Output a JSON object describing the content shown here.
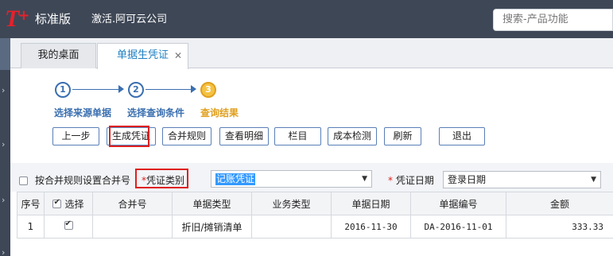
{
  "app": {
    "logo_mark": "T",
    "edition": "标准版",
    "company": "激活.阿可云公司",
    "search_placeholder": "搜索-产品功能"
  },
  "tabs": [
    {
      "label": "我的桌面"
    },
    {
      "label": "单据生凭证"
    }
  ],
  "steps": [
    {
      "number": "1",
      "label": "选择来源单据"
    },
    {
      "number": "2",
      "label": "选择查询条件"
    },
    {
      "number": "3",
      "label": "查询结果"
    }
  ],
  "toolbar": {
    "prev": "上一步",
    "generate": "生成凭证",
    "merge_rule": "合并规则",
    "view_detail": "查看明细",
    "columns": "栏目",
    "cost_check": "成本检测",
    "refresh": "刷新",
    "exit": "退出"
  },
  "filter": {
    "merge_checkbox_label": "按合并规则设置合并号",
    "merge_checked": false,
    "required_mark": "*",
    "voucher_type_label": "凭证类别",
    "voucher_type_value": "记账凭证",
    "voucher_date_label": "凭证日期",
    "voucher_date_value": "登录日期"
  },
  "table": {
    "headers": [
      "序号",
      "选择",
      "合并号",
      "单据类型",
      "业务类型",
      "单据日期",
      "单据编号",
      "金额"
    ],
    "rows": [
      {
        "seq": "1",
        "selected": true,
        "merge_no": "",
        "doc_type": "折旧/摊销清单",
        "biz_type": "",
        "doc_date": "2016-11-30",
        "doc_no": "DA-2016-11-01",
        "amount": "333.33"
      }
    ]
  },
  "colors": {
    "topbar": "#3e4756",
    "accent": "#1d7fc3",
    "highlight_box": "#e02020",
    "current_step": "#e0a020"
  }
}
